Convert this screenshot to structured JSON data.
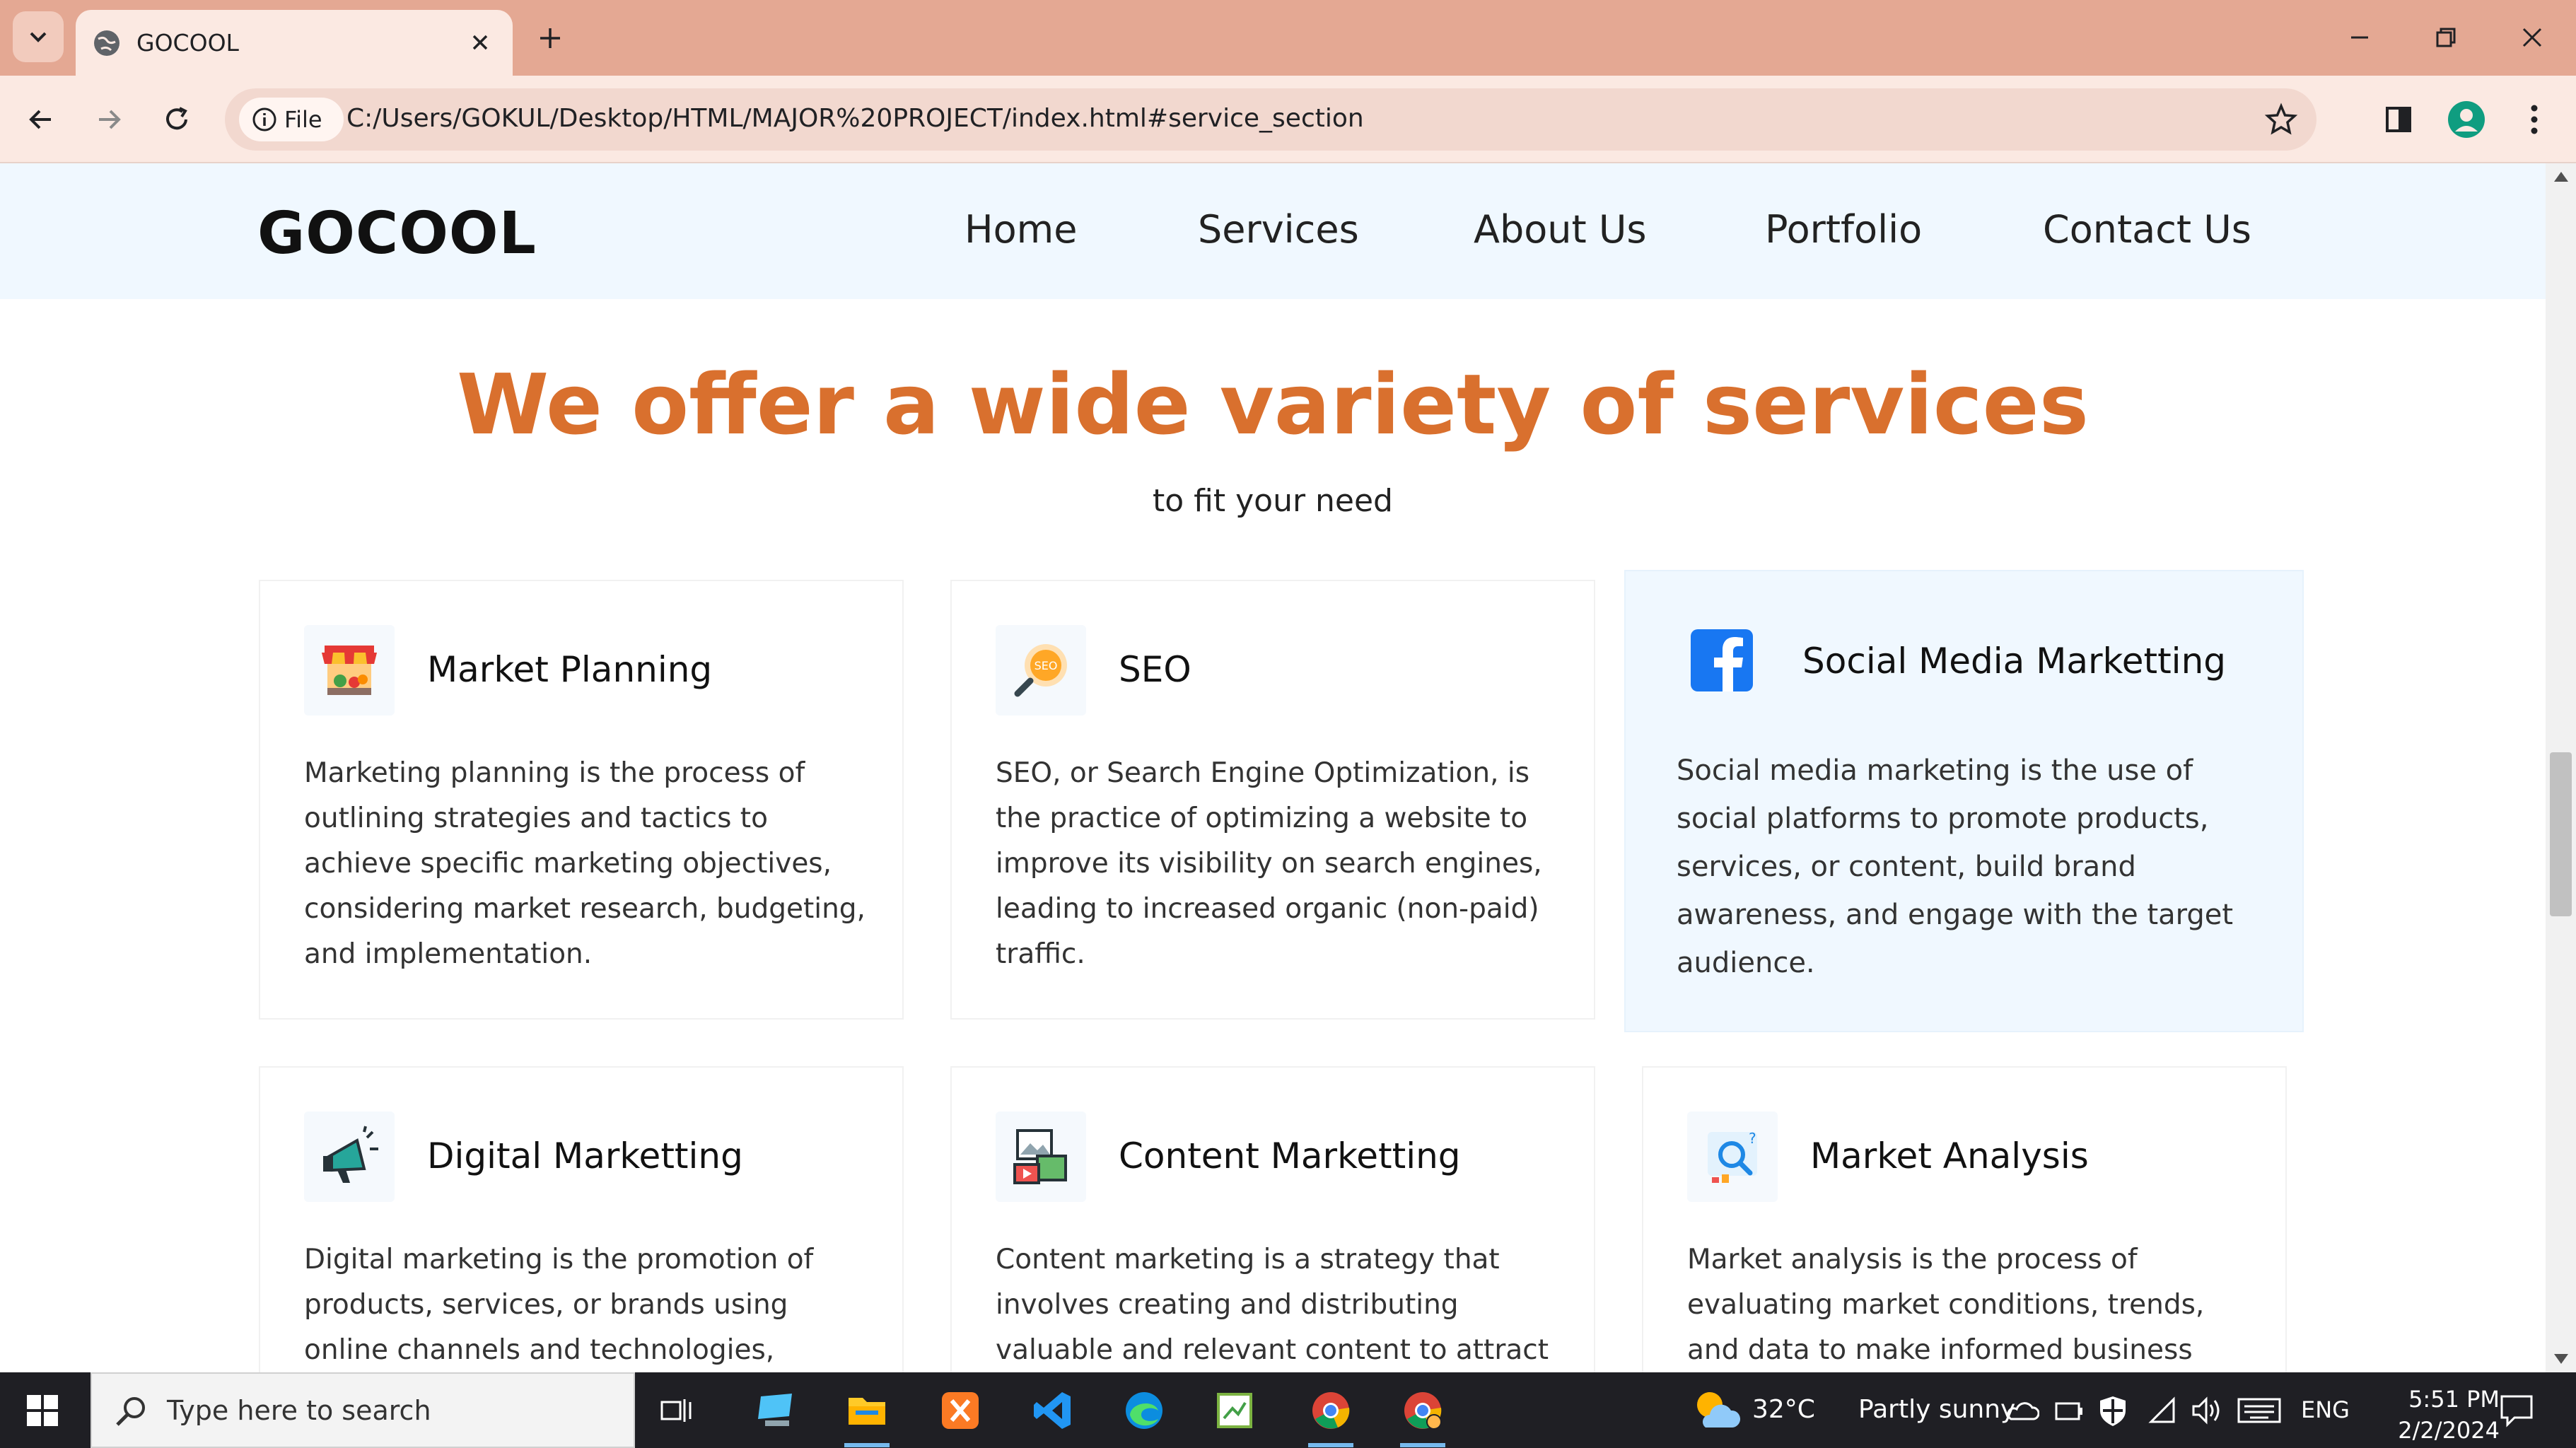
{
  "browser": {
    "tab_title": "GOCOOL",
    "file_chip": "File",
    "url": "C:/Users/GOKUL/Desktop/HTML/MAJOR%20PROJECT/index.html#service_section"
  },
  "site": {
    "logo": "GOCOOL",
    "nav": [
      "Home",
      "Services",
      "About Us",
      "Portfolio",
      "Contact Us"
    ],
    "headline": "We offer a wide variety of services",
    "subline": "to fit your need",
    "accent_color": "#d9702e",
    "cards": [
      {
        "title": "Market Planning",
        "icon": "market-stall-icon",
        "text": "Marketing planning is the process of outlining strategies and tactics to achieve specific marketing objectives, considering market research, budgeting, and implementation."
      },
      {
        "title": "SEO",
        "icon": "seo-magnifier-icon",
        "text": "SEO, or Search Engine Optimization, is the practice of optimizing a website to improve its visibility on search engines, leading to increased organic (non-paid) traffic."
      },
      {
        "title": "Social Media Marketting",
        "icon": "facebook-icon",
        "text": "Social media marketing is the use of social platforms to promote products, services, or content, build brand awareness, and engage with the target audience."
      },
      {
        "title": "Digital Marketting",
        "icon": "megaphone-icon",
        "text": "Digital marketing is the promotion of products, services, or brands using online channels and technologies, including"
      },
      {
        "title": "Content Marketting",
        "icon": "content-media-icon",
        "text": "Content marketing is a strategy that involves creating and distributing valuable and relevant content to attract and"
      },
      {
        "title": "Market Analysis",
        "icon": "analysis-magnifier-icon",
        "text": "Market analysis is the process of evaluating market conditions, trends, and data to make informed business decisions"
      }
    ]
  },
  "taskbar": {
    "search_placeholder": "Type here to search",
    "weather_temp": "32°C",
    "weather_text": "Partly sunny",
    "language": "ENG",
    "time": "5:51 PM",
    "date": "2/2/2024"
  }
}
